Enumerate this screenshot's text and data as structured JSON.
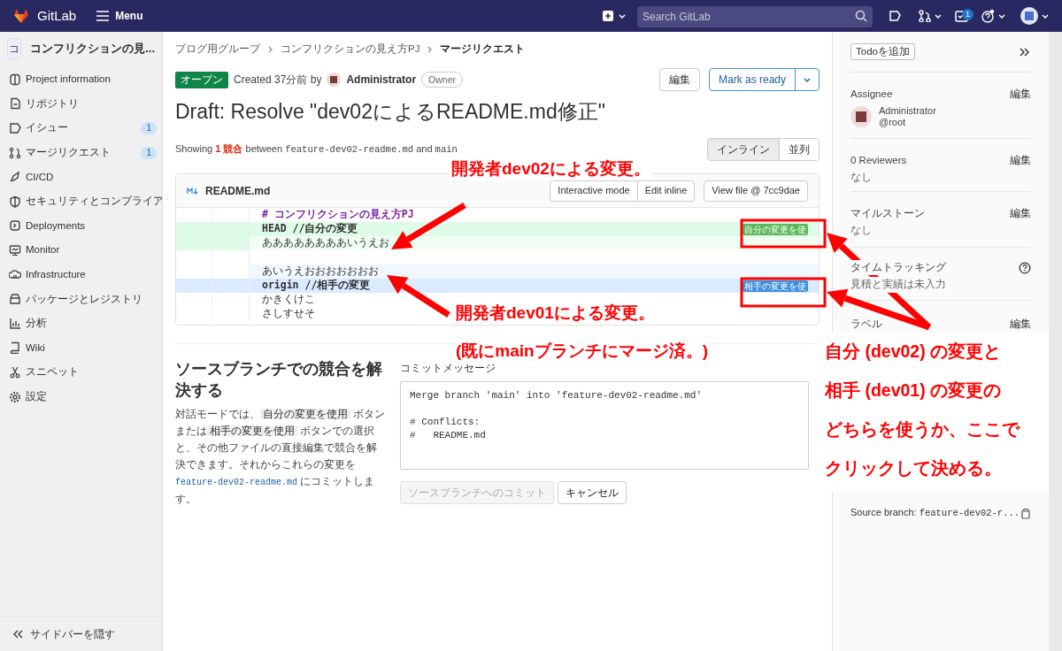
{
  "topbar": {
    "brand": "GitLab",
    "menu": "Menu",
    "search": {
      "placeholder": "Search GitLab"
    },
    "todo_count": "1"
  },
  "sidebar": {
    "project_initial": "コ",
    "project_name": "コンフリクションの見...",
    "items": [
      {
        "label": "Project information"
      },
      {
        "label": "リポジトリ"
      },
      {
        "label": "イシュー",
        "badge": "1"
      },
      {
        "label": "マージリクエスト",
        "badge": "1"
      },
      {
        "label": "CI/CD"
      },
      {
        "label": "セキュリティとコンプライア"
      },
      {
        "label": "Deployments"
      },
      {
        "label": "Monitor"
      },
      {
        "label": "Infrastructure"
      },
      {
        "label": "パッケージとレジストリ"
      },
      {
        "label": "分析"
      },
      {
        "label": "Wiki"
      },
      {
        "label": "スニペット"
      },
      {
        "label": "設定"
      }
    ],
    "collapse": "サイドバーを隠す"
  },
  "breadcrumbs": [
    "ブログ用グループ",
    "コンフリクションの見え方PJ",
    "マージリクエスト"
  ],
  "merge_request": {
    "status": "オープン",
    "created": "Created 37分前 by",
    "author": "Administrator",
    "role": "Owner",
    "edit_button": "編集",
    "ready_button": "Mark as ready",
    "title": "Draft: Resolve \"dev02によるREADME.md修正\""
  },
  "summary": {
    "showing": "Showing",
    "count": "1 競合",
    "between": "between",
    "source": "feature-dev02-readme.md",
    "and": "and",
    "target": "main"
  },
  "view_toggle": [
    {
      "label": "インライン",
      "selected": true
    },
    {
      "label": "並列",
      "selected": false
    }
  ],
  "file": {
    "name": "README.md",
    "buttons": [
      "Interactive mode",
      "Edit inline",
      "View file @ 7cc9dae"
    ],
    "lines": [
      {
        "kind": "context",
        "text": "# コンフリクションの見え方PJ"
      },
      {
        "kind": "ours-header",
        "text": "HEAD //自分の変更",
        "button": "自分の変更を使"
      },
      {
        "kind": "ours",
        "text": "ああああああああいうえお"
      },
      {
        "kind": "spacer"
      },
      {
        "kind": "theirs",
        "text": "あいうえおおおおおおお"
      },
      {
        "kind": "theirs-header",
        "text": "origin //相手の変更",
        "button": "相手の変更を使"
      },
      {
        "kind": "plain",
        "text": "かきくけこ"
      },
      {
        "kind": "plain",
        "text": "さしすせそ"
      }
    ]
  },
  "resolve": {
    "heading": "ソースブランチでの競合を解決する",
    "description": [
      {
        "kind": "text",
        "text": "対話モードでは、"
      },
      {
        "kind": "chip",
        "text": "自分の変更を使用"
      },
      {
        "kind": "text",
        "text": " ボタンまたは"
      },
      {
        "kind": "chip",
        "text": "相手の変更を使用"
      },
      {
        "kind": "text",
        "text": " ボタンでの選択と、その他ファイルの直接編集で競合を解決できます。それからこれらの変更を "
      },
      {
        "kind": "code",
        "text": "feature-dev02-readme.md"
      },
      {
        "kind": "text",
        "text": " にコミットします。"
      }
    ],
    "commit_label": "コミットメッセージ",
    "commit_message": "Merge branch 'main' into 'feature-dev02-readme.md'\n\n# Conflicts:\n#   README.md",
    "buttons": [
      {
        "label": "ソースブランチへのコミット",
        "disabled": true
      },
      {
        "label": "キャンセル",
        "disabled": false
      }
    ]
  },
  "right_sidebar": {
    "todo_button": "Todoを追加",
    "assignee": {
      "label": "Assignee",
      "edit": "編集",
      "name": "Administrator",
      "username": "@root"
    },
    "reviewers": {
      "label": "0 Reviewers",
      "edit": "編集",
      "value": "なし"
    },
    "milestone": {
      "label": "マイルストーン",
      "edit": "編集",
      "value": "なし"
    },
    "time_tracking": {
      "label": "タイムトラッキング",
      "value": "見積と実績は未入力"
    },
    "labels": {
      "label": "ラベル",
      "edit": "編集"
    },
    "source_branch": {
      "label": "Source branch:",
      "value": "feature-dev02-r..."
    }
  },
  "annotations": {
    "callouts": [
      "開発者dev02による変更。",
      "開発者dev01による変更。",
      "(既にmainブランチにマージ済。)"
    ],
    "note": [
      "自分 (dev02) の変更と",
      "相手 (dev01) の変更の",
      "どちらを使うか、ここで",
      "クリックして決める。"
    ]
  }
}
